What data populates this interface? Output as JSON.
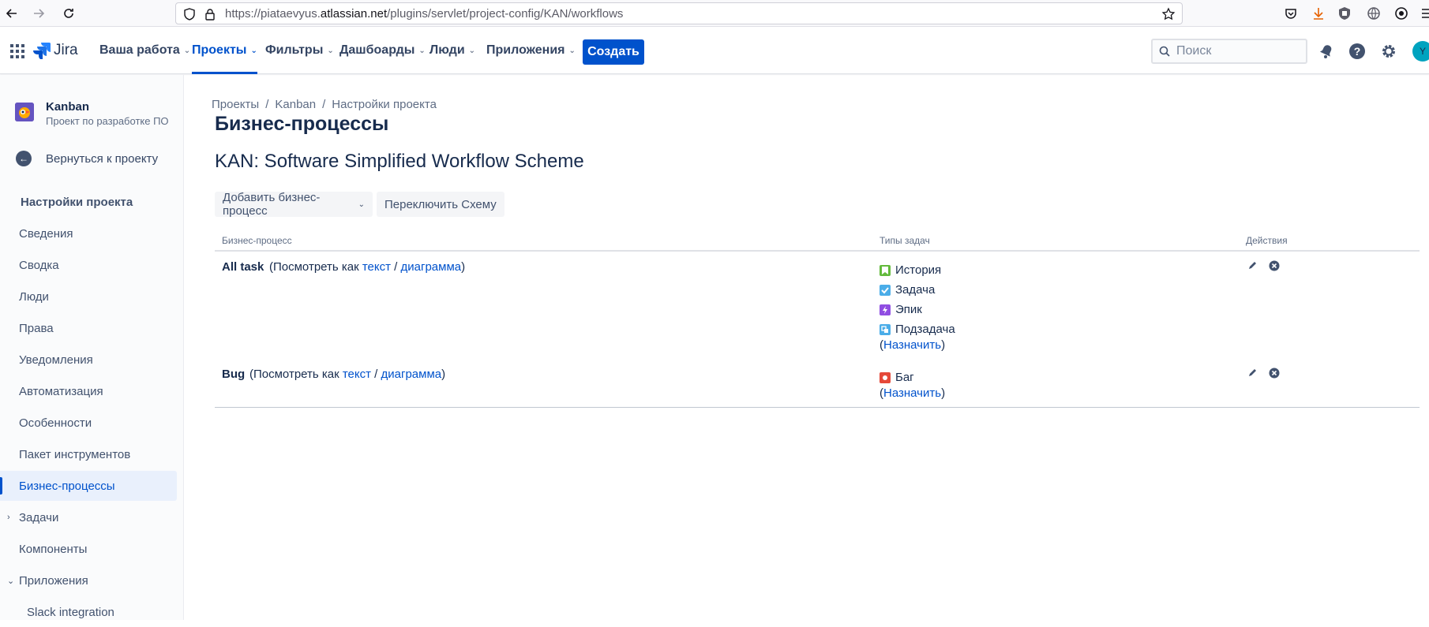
{
  "browser": {
    "url_prefix": "https://piataevyus.",
    "url_domain": "atlassian.net",
    "url_path": "/plugins/servlet/project-config/KAN/workflows"
  },
  "topnav": {
    "logo": "Jira",
    "menu": [
      "Ваша работа",
      "Проекты",
      "Фильтры",
      "Дашбоарды",
      "Люди",
      "Приложения"
    ],
    "create": "Создать",
    "search_placeholder": "Поиск",
    "avatar_initial": "Y",
    "accent": "#0052cc"
  },
  "sidebar": {
    "project_name": "Kanban",
    "project_type": "Проект по разработке ПО",
    "back": "Вернуться к проекту",
    "section": "Настройки проекта",
    "items": [
      "Сведения",
      "Сводка",
      "Люди",
      "Права",
      "Уведомления",
      "Автоматизация",
      "Особенности",
      "Пакет инструментов",
      "Бизнес-процессы",
      "Задачи",
      "Компоненты",
      "Приложения",
      "Slack integration"
    ]
  },
  "main": {
    "breadcrumbs": [
      "Проекты",
      "Kanban",
      "Настройки проекта"
    ],
    "title": "Бизнес-процессы",
    "scheme": "KAN: Software Simplified Workflow Scheme",
    "add_button": "Добавить бизнес-процесс",
    "switch_button": "Переключить Схему",
    "columns": [
      "Бизнес-процесс",
      "Типы задач",
      "Действия"
    ],
    "view_as": "(Посмотреть как",
    "text_link": "текст",
    "diagram_link": "диаграмма",
    "assign": "Назначить",
    "workflows": [
      {
        "name": "All task",
        "issue_types": [
          "История",
          "Задача",
          "Эпик",
          "Подзадача"
        ]
      },
      {
        "name": "Bug",
        "issue_types": [
          "Баг"
        ]
      }
    ]
  }
}
